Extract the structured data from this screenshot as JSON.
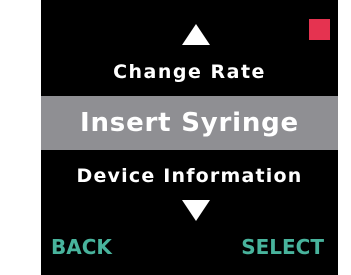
{
  "colors": {
    "screen_background": "#000000",
    "text": "#ffffff",
    "selected_background": "#8f8f93",
    "softkey_text": "#48b39c",
    "status_indicator": "#e53350"
  },
  "icons": {
    "scroll_up": "triangle-up-icon",
    "scroll_down": "triangle-down-icon",
    "status": "red-square-indicator"
  },
  "menu": {
    "previous_item": "Change Rate",
    "selected_item": "Insert Syringe",
    "next_item": "Device Information"
  },
  "softkeys": {
    "left": "BACK",
    "right": "SELECT"
  }
}
